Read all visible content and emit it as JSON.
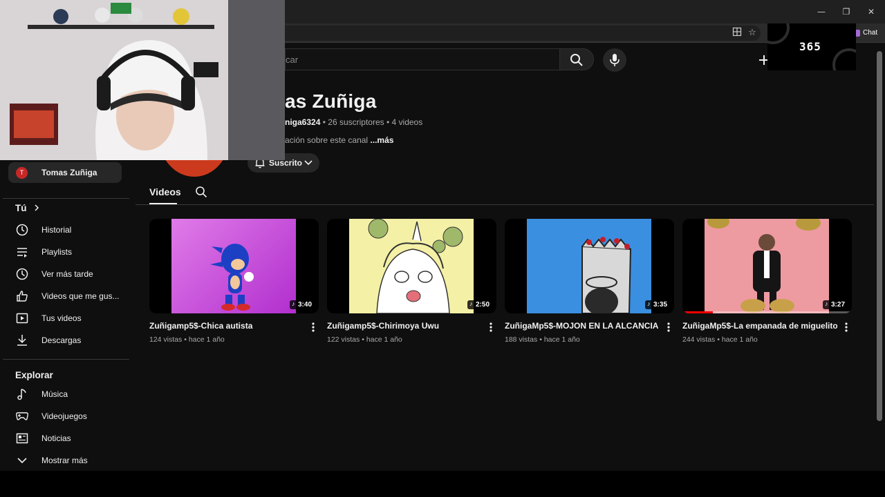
{
  "browser": {
    "chat_label": "Chat",
    "window_controls": [
      "minimize-icon",
      "restore-icon",
      "close-icon"
    ]
  },
  "header": {
    "search_placeholder": "car",
    "icons": [
      "search-icon",
      "mic-icon",
      "create-icon"
    ]
  },
  "overlay": {
    "logo_text": "365"
  },
  "channel": {
    "name": "as Zuñiga",
    "handle": "niga6324",
    "subscribers": "26 suscriptores",
    "videos_count": "4 videos",
    "separator": "•",
    "description": "ación sobre este canal",
    "more_label": "...más",
    "subscribed_label": "Suscrito",
    "avatar_color": "#cc3a1d"
  },
  "tabs": {
    "videos_label": "Videos"
  },
  "sidebar": {
    "user": {
      "initial": "T",
      "name": "Tomas Zuñiga"
    },
    "you_section": {
      "title": "Tú",
      "items": [
        {
          "label": "Historial",
          "icon": "history-icon"
        },
        {
          "label": "Playlists",
          "icon": "playlists-icon"
        },
        {
          "label": "Ver más tarde",
          "icon": "watch-later-icon"
        },
        {
          "label": "Videos que me gus...",
          "icon": "liked-videos-icon"
        },
        {
          "label": "Tus videos",
          "icon": "your-videos-icon"
        },
        {
          "label": "Descargas",
          "icon": "downloads-icon"
        }
      ]
    },
    "explore_section": {
      "title": "Explorar",
      "items": [
        {
          "label": "Música",
          "icon": "music-icon"
        },
        {
          "label": "Videojuegos",
          "icon": "gaming-icon"
        },
        {
          "label": "Noticias",
          "icon": "news-icon"
        },
        {
          "label": "Mostrar más",
          "icon": "chevron-down-icon"
        }
      ]
    }
  },
  "videos": [
    {
      "title": "Zuñigamp5$-Chica autista",
      "views": "124 vistas",
      "age": "hace 1 año",
      "duration": "3:40",
      "thumb_color": "#c53fd6"
    },
    {
      "title": "Zuñigamp5$-Chirimoya Uwu",
      "views": "122 vistas",
      "age": "hace 1 año",
      "duration": "2:50",
      "thumb_color": "#f3ef9d"
    },
    {
      "title": "ZuñigaMp5$-MOJON EN LA ALCANCIA 💩",
      "views": "188 vistas",
      "age": "hace 1 año",
      "duration": "3:35",
      "thumb_color": "#3b8fe0"
    },
    {
      "title": "ZuñigaMp5$-La empanada de miguelito",
      "views": "244 vistas",
      "age": "hace 1 año",
      "duration": "3:27",
      "thumb_color": "#ee9aa1",
      "watched_fraction": 0.18
    }
  ],
  "meta_separator": "•"
}
